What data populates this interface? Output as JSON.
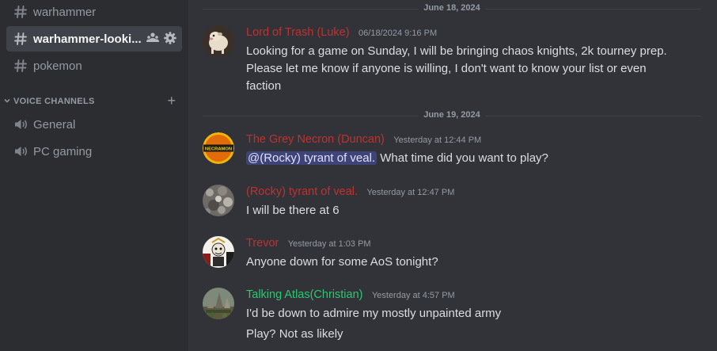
{
  "sidebar": {
    "channels": [
      {
        "name": "warhammer"
      },
      {
        "name": "warhammer-looki..."
      },
      {
        "name": "pokemon"
      }
    ],
    "voice_category": "VOICE CHANNELS",
    "voice_channels": [
      {
        "name": "General"
      },
      {
        "name": "PC gaming"
      }
    ]
  },
  "dividers": [
    "June 18, 2024",
    "June 19, 2024"
  ],
  "messages": [
    {
      "author": "Lord of Trash (Luke)",
      "author_color": "#c0312f",
      "timestamp": "06/18/2024 9:16 PM",
      "lines": [
        "Looking for a game on Sunday,  I will be bringing chaos knights,  2k tourney prep.  Please let me know if anyone is willing,  I don't want to know your list or even faction"
      ]
    },
    {
      "author": "The Grey Necron (Duncan)",
      "author_color": "#c0312f",
      "timestamp": "Yesterday at 12:44 PM",
      "mention": "@(Rocky) tyrant of veal.",
      "text": " What time did you want to play?",
      "avatar_text": "NECRAMON"
    },
    {
      "author": "(Rocky) tyrant of veal.",
      "author_color": "#c0312f",
      "timestamp": "Yesterday at 12:47 PM",
      "lines": [
        "I will be there at 6"
      ]
    },
    {
      "author": "Trevor",
      "author_color": "#c0312f",
      "timestamp": "Yesterday at 1:03 PM",
      "lines": [
        "Anyone down for some AoS tonight?"
      ]
    },
    {
      "author": "Talking Atlas(Christian)",
      "author_color": "#2dc770",
      "timestamp": "Yesterday at 4:57 PM",
      "lines": [
        "I'd be down to admire my mostly unpainted army",
        "Play? Not as likely"
      ]
    }
  ],
  "colors": {
    "sidebar_bg": "#2b2d31",
    "main_bg": "#313338",
    "active_channel_bg": "#404249",
    "mention_bg": "#5865f2"
  }
}
